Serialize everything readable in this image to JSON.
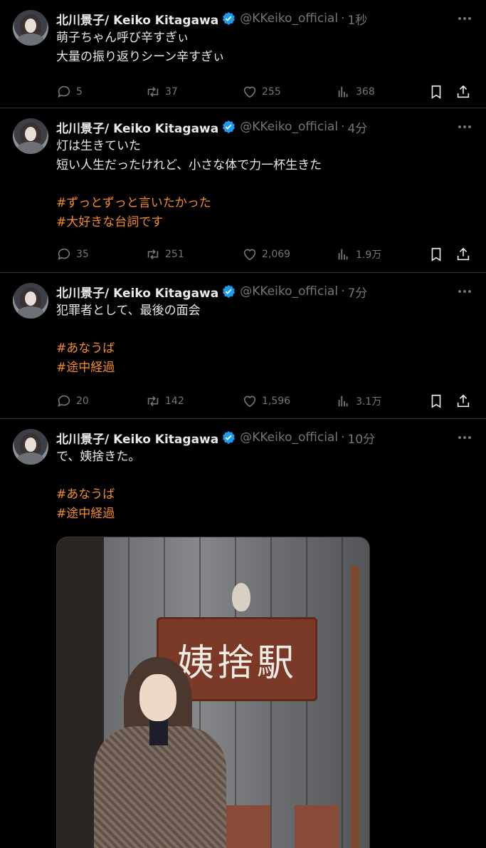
{
  "account": {
    "name": "北川景子/ Keiko Kitagawa",
    "handle": "@KKeiko_official"
  },
  "tweets": [
    {
      "time": "1秒",
      "lines": [
        "萌子ちゃん呼び辛すぎぃ",
        "大量の振り返りシーン辛すぎぃ"
      ],
      "hashtags": [],
      "replies": "5",
      "retweets": "37",
      "likes": "255",
      "views": "368"
    },
    {
      "time": "4分",
      "lines": [
        "灯は生きていた",
        "短い人生だったけれど、小さな体で力一杯生きた"
      ],
      "hashtags": [
        "#ずっとずっと言いたかった",
        "#大好きな台詞です"
      ],
      "replies": "35",
      "retweets": "251",
      "likes": "2,069",
      "views": "1.9万"
    },
    {
      "time": "7分",
      "lines": [
        "犯罪者として、最後の面会"
      ],
      "hashtags": [
        "#あなうば",
        "#途中経過"
      ],
      "replies": "20",
      "retweets": "142",
      "likes": "1,596",
      "views": "3.1万"
    },
    {
      "time": "10分",
      "lines": [
        "で、姨捨きた。"
      ],
      "hashtags": [
        "#あなうば",
        "#途中経過"
      ],
      "image_sign": "姨捨駅"
    }
  ],
  "colors": {
    "background": "#000000",
    "text": "#e7e9ea",
    "muted": "#71767b",
    "hashtag": "#f28c28",
    "verified": "#1d9bf0"
  }
}
